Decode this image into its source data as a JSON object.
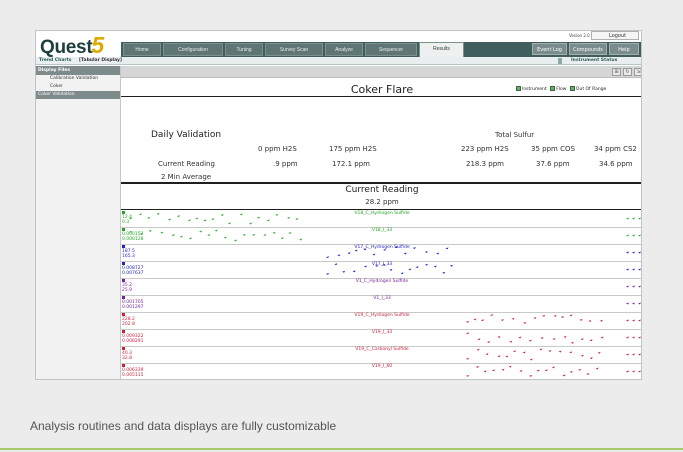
{
  "header": {
    "logo_text": "Quest",
    "logo_digit": "5",
    "user_label": "Vesion 2.0",
    "logout": "Logout",
    "nav_tabs": [
      "Home",
      "Configuration",
      "Tuning",
      "Survey Scan",
      "Analyze",
      "Sequencer",
      "Results"
    ],
    "active_tab": "Results",
    "right_buttons": [
      "Event Log",
      "Compounds",
      "Help"
    ]
  },
  "subnav": {
    "trend_charts": "Trend Charts",
    "tabular_display": "[Tabular Display]",
    "instrument_status": "Instrument Status"
  },
  "sidebar": {
    "header": "Display Files",
    "items": [
      "Calibration Validation",
      "Coker"
    ],
    "selected": "Coker Validation"
  },
  "main": {
    "title": "Coker Flare",
    "legend": [
      "Instrument",
      "Flow",
      "Out Of Range"
    ],
    "legend_colors": [
      "#4bc44b",
      "#4bc44b",
      "#4bc44b"
    ],
    "daily_validation": "Daily Validation",
    "total_sulfur": "Total Sulfur",
    "columns": [
      "0 ppm H2S",
      "175 ppm H2S",
      "223 ppm H2S",
      "35 ppm COS",
      "34 ppm CS2"
    ],
    "current_reading_label": "Current Reading",
    "current_values": [
      ".9 ppm",
      "172.1 ppm",
      "218.3 ppm",
      "37.6 ppm",
      "34.6 ppm"
    ],
    "two_min_avg": "2 Min Average",
    "current_reading_title": "Current Reading",
    "current_reading_value": "28.2 ppm"
  },
  "traces": [
    {
      "name": "V18_C_Hydrogen Sulfide",
      "color": "#23a823",
      "values": [
        "12.4",
        "0.3"
      ]
    },
    {
      "name": "V18_I_33",
      "color": "#23a823",
      "values": [
        "0.000152",
        "0.000128"
      ]
    },
    {
      "name": "V17_C_Hydrogen Sulfide",
      "color": "#2222c8",
      "values": [
        "187.5",
        "165.3"
      ]
    },
    {
      "name": "V17_I_33",
      "color": "#2222c8",
      "values": [
        "0.008727",
        "0.007637"
      ]
    },
    {
      "name": "V1_C_Hydrogen Sulfide",
      "color": "#7a1f9e",
      "values": [
        "35.2",
        "25.9"
      ]
    },
    {
      "name": "V1_I_33",
      "color": "#7a1f9e",
      "values": [
        "0.001705",
        "0.001297"
      ]
    },
    {
      "name": "V19_C_Hydrogen Sulfide",
      "color": "#d01f3a",
      "values": [
        "228.2",
        "202.8"
      ]
    },
    {
      "name": "V19_I_33",
      "color": "#d01f3a",
      "values": [
        "0.009322",
        "0.008291"
      ]
    },
    {
      "name": "V19_C_Carbonyl Sulfide",
      "color": "#d01f3a",
      "values": [
        "40.3",
        "32.8"
      ]
    },
    {
      "name": "V19_I_60",
      "color": "#d01f3a",
      "values": [
        "0.006339",
        "0.005115"
      ]
    }
  ],
  "caption": "Analysis routines and data displays are fully customizable"
}
